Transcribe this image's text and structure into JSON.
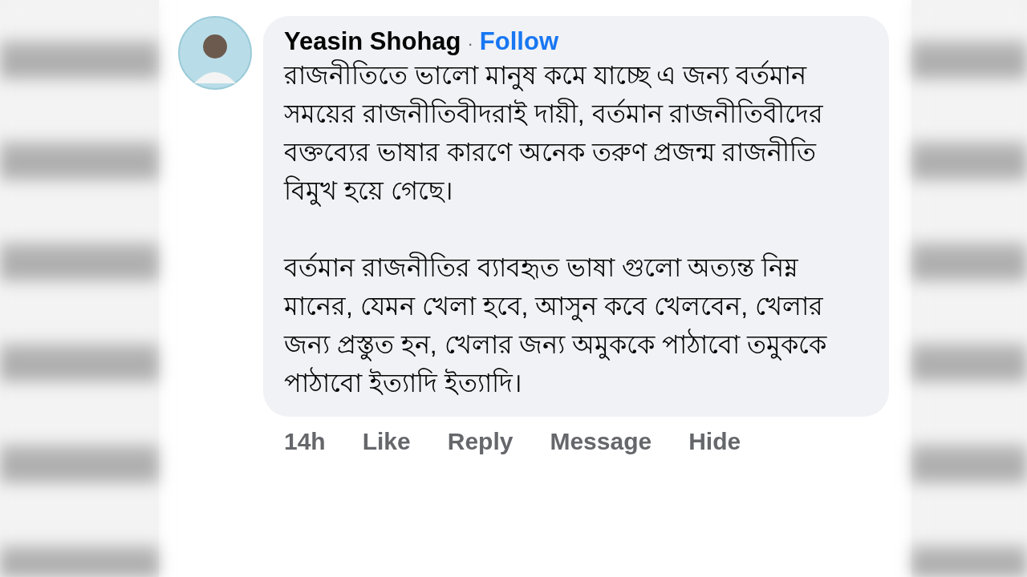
{
  "comment": {
    "author": "Yeasin Shohag",
    "separator": "·",
    "follow": "Follow",
    "paragraphs": [
      "রাজনীতিতে ভালো মানুষ কমে যাচ্ছে এ জন্য বর্তমান সময়ের রাজনীতিবীদরাই দায়ী, বর্তমান রাজনীতিবীদের বক্তব্যের ভাষার কারণে অনেক তরুণ প্রজন্ম রাজনীতি বিমুখ হয়ে গেছে।",
      "বর্তমান রাজনীতির ব্যাবহৃত ভাষা গুলো অত্যন্ত নিম্ন মানের, যেমন খেলা হবে, আসুন কবে খেলবেন, খেলার জন্য প্রস্তুত হন, খেলার জন্য অমুককে পাঠাবো তমুককে পাঠাবো ইত্যাদি ইত্যাদি।"
    ],
    "time": "14h",
    "actions": [
      "Like",
      "Reply",
      "Message",
      "Hide"
    ]
  }
}
